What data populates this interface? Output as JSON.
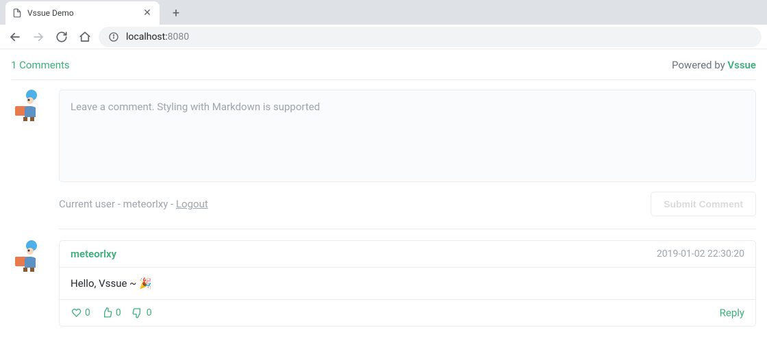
{
  "browser": {
    "tab_title": "Vssue Demo",
    "url_host": "localhost:",
    "url_port": "8080"
  },
  "header": {
    "count_label": "1 Comments",
    "powered_prefix": "Powered by ",
    "powered_link": "Vssue"
  },
  "composer": {
    "placeholder": "Leave a comment. Styling with Markdown is supported"
  },
  "user": {
    "prefix": "Current user - ",
    "name": "meteorlxy",
    "sep": " - ",
    "logout": "Logout"
  },
  "submit_label": "Submit Comment",
  "comment": {
    "author": "meteorlxy",
    "timestamp": "2019-01-02 22:30:20",
    "body": "Hello, Vssue ~ 🎉",
    "reactions": {
      "heart": "0",
      "thumbs_up": "0",
      "thumbs_down": "0"
    },
    "reply_label": "Reply"
  },
  "accent_color": "#3eaf7c"
}
